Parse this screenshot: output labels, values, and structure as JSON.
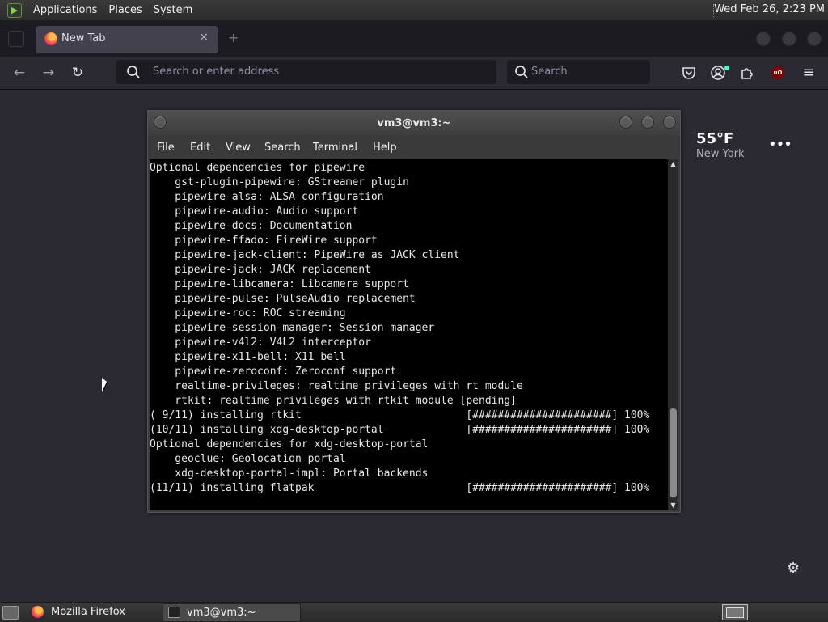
{
  "top_panel": {
    "menus": [
      "Applications",
      "Places",
      "System"
    ],
    "clock": "Wed Feb 26,  2:23 PM"
  },
  "browser": {
    "tab_title": "New Tab",
    "tab_close": "×",
    "new_tab": "+",
    "url_placeholder": "Search or enter address",
    "search_placeholder": "Search",
    "nav": {
      "back": "←",
      "forward": "→",
      "reload": "↻"
    },
    "toolbar_icons": [
      "pocket-icon",
      "account-icon",
      "extensions-icon",
      "ublock-icon",
      "menu-icon"
    ],
    "ublock_label": "uO",
    "menu_glyph": "≡"
  },
  "weather": {
    "temp": "55°F",
    "city": "New York",
    "menu": "•••"
  },
  "settings_glyph": "⚙",
  "terminal": {
    "title": "vm3@vm3:~",
    "menu": [
      "File",
      "Edit",
      "View",
      "Search",
      "Terminal",
      "Help"
    ],
    "lines": [
      "Optional dependencies for pipewire",
      "    gst-plugin-pipewire: GStreamer plugin",
      "    pipewire-alsa: ALSA configuration",
      "    pipewire-audio: Audio support",
      "    pipewire-docs: Documentation",
      "    pipewire-ffado: FireWire support",
      "    pipewire-jack-client: PipeWire as JACK client",
      "    pipewire-jack: JACK replacement",
      "    pipewire-libcamera: Libcamera support",
      "    pipewire-pulse: PulseAudio replacement",
      "    pipewire-roc: ROC streaming",
      "    pipewire-session-manager: Session manager",
      "    pipewire-v4l2: V4L2 interceptor",
      "    pipewire-x11-bell: X11 bell",
      "    pipewire-zeroconf: Zeroconf support",
      "    realtime-privileges: realtime privileges with rt module",
      "    rtkit: realtime privileges with rtkit module [pending]",
      "( 9/11) installing rtkit                          [######################] 100%",
      "(10/11) installing xdg-desktop-portal             [######################] 100%",
      "Optional dependencies for xdg-desktop-portal",
      "    geoclue: Geolocation portal",
      "    xdg-desktop-portal-impl: Portal backends",
      "(11/11) installing flatpak                        [######################] 100%"
    ]
  },
  "taskbar": {
    "tasks": [
      "Mozilla Firefox",
      "vm3@vm3:~"
    ]
  }
}
